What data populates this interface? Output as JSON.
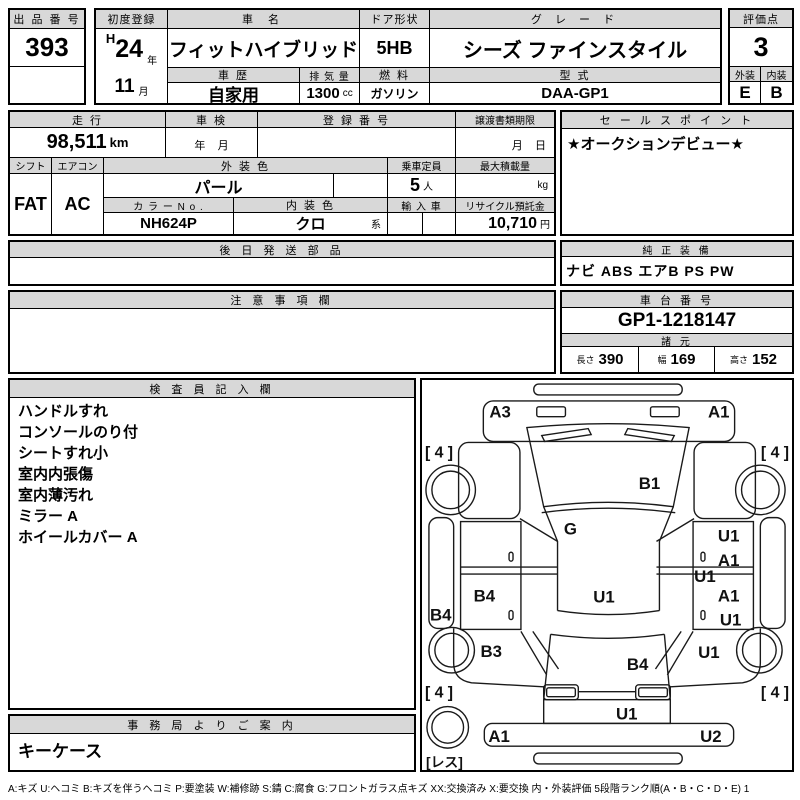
{
  "top": {
    "auction_no": {
      "label": "出 品 番 号",
      "value": "393"
    },
    "first_reg": {
      "label": "初度登録",
      "era": "H",
      "year": "24",
      "year_unit": "年",
      "month": "11",
      "month_unit": "月"
    },
    "car_name": {
      "label": "車  名",
      "value": "フィットハイブリッド"
    },
    "history": {
      "label": "車 歴",
      "value": "自家用"
    },
    "displacement": {
      "label": "排 気 量",
      "value": "1300",
      "unit": "cc"
    },
    "door": {
      "label": "ドア形状",
      "value": "5HB"
    },
    "fuel": {
      "label": "燃 料",
      "value": "ガソリン"
    },
    "grade": {
      "label": "グ レ ー ド",
      "value": "シーズ ファインスタイル"
    },
    "model": {
      "label": "型 式",
      "value": "DAA-GP1"
    },
    "score": {
      "label": "評価点",
      "value": "3"
    },
    "exterior": {
      "label": "外装",
      "value": "E"
    },
    "interior": {
      "label": "内装",
      "value": "B"
    }
  },
  "info": {
    "mileage": {
      "label": "走 行",
      "value": "98,511",
      "unit": "km"
    },
    "shaken": {
      "label": "車 検",
      "value": "年    月"
    },
    "reg_no": {
      "label": "登 録 番 号",
      "value": ""
    },
    "transfer": {
      "label": "譲渡書類期限",
      "value": "月    日"
    },
    "shift": {
      "label": "シフト",
      "value": "FAT"
    },
    "aircon": {
      "label": "エアコン",
      "value": "AC"
    },
    "ext_color": {
      "label": "外 装 色",
      "value": "パール"
    },
    "capacity": {
      "label": "乗車定員",
      "value": "5",
      "unit": "人"
    },
    "max_load": {
      "label": "最大積載量",
      "unit": "kg"
    },
    "color_no": {
      "label": "カ ラ ー N o .",
      "value": "NH624P"
    },
    "int_color": {
      "label": "内 装 色",
      "value": "クロ",
      "suffix": "系"
    },
    "import_car": {
      "label": "輸 入 車",
      "value": ""
    },
    "recycle": {
      "label": "リサイクル預託金",
      "value": "10,710",
      "unit": "円"
    }
  },
  "sections": {
    "later_parts": {
      "label": "後 日 発 送 部 品",
      "content": ""
    },
    "caution": {
      "label": "注 意 事 項 欄",
      "content": ""
    },
    "sales_point": {
      "label": "セ ー ル ス ポ イ ン ト",
      "content": "★オークションデビュー★"
    },
    "equipment": {
      "label": "純 正 装 備",
      "content": "ナビ ABS エアB PS PW"
    },
    "chassis": {
      "label": "車 台 番 号",
      "value": "GP1-1218147"
    },
    "specs": {
      "label": "諸 元",
      "length_label": "長さ",
      "length": "390",
      "width_label": "幅",
      "width": "169",
      "height_label": "高さ",
      "height": "152"
    },
    "inspector": {
      "label": "検 査 員 記 入 欄",
      "lines": [
        "ハンドルすれ",
        "コンソールのり付",
        "シートすれ小",
        "室内内張傷",
        "室内薄汚れ",
        "ミラー A",
        "ホイールカバー A"
      ]
    },
    "office": {
      "label": "事 務 局 よ り ご 案 内",
      "content": "キーケース"
    }
  },
  "diagram": {
    "front_bumper_left": "A3",
    "front_bumper_right": "A1",
    "hood": "B1",
    "windshield": "G",
    "roof": "U1",
    "left_door_front": "B4",
    "left_rocker": "B4",
    "left_rear_quarter": "B3",
    "right_door_front_top": "U1",
    "right_door_front_bottom": "A1",
    "right_door_seam": "U1",
    "right_rear_door_top": "A1",
    "right_rear_door_bottom": "U1",
    "right_rear_quarter": "U1",
    "rear_window": "B4",
    "tailgate": "U1",
    "rear_bumper_left": "A1",
    "rear_bumper_right": "U2",
    "tire_fl": "[ 4 ]",
    "tire_fr": "[ 4 ]",
    "tire_rl": "[ 4 ]",
    "tire_rr": "[ 4 ]",
    "spare": "[レス]"
  },
  "legend": "A:キズ U:ヘコミ B:キズを伴うヘコミ P:要塗装 W:補修跡 S:錆 C:腐食 G:フロントガラス点キズ XX:交換済み X:要交換  内・外装評価 5段階ランク順(A・B・C・D・E) 1"
}
